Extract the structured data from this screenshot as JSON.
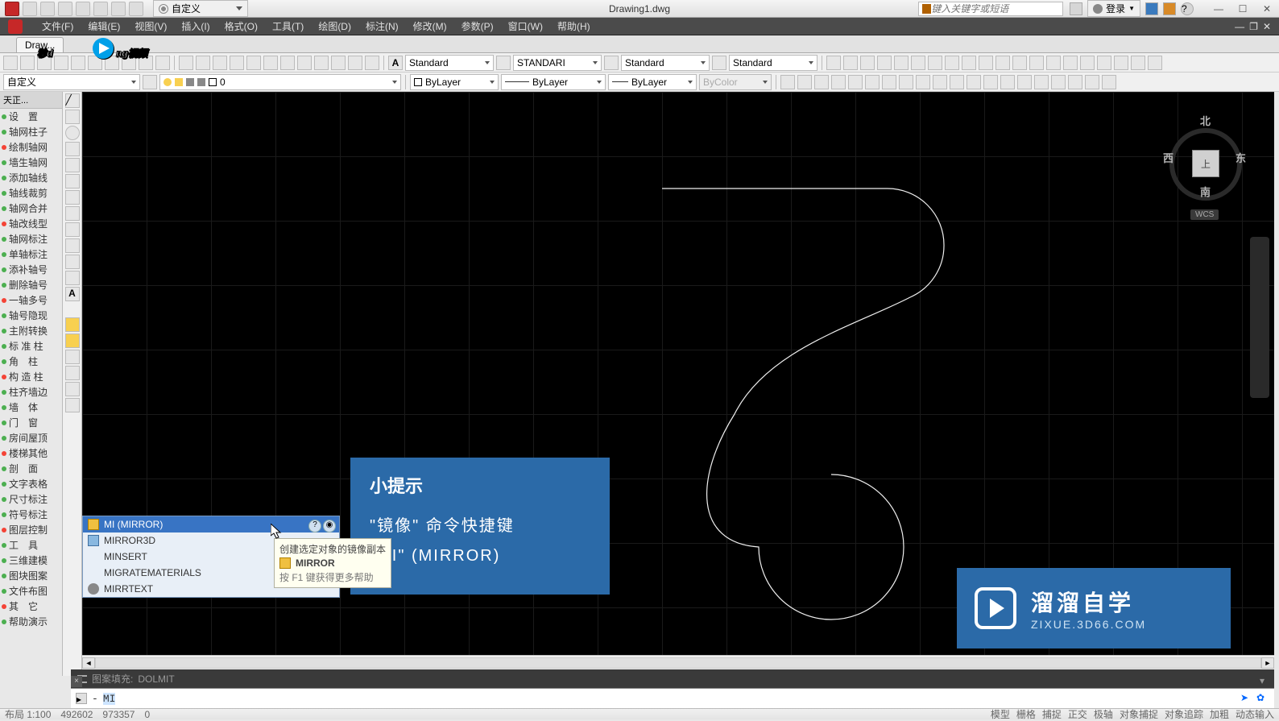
{
  "title_bar": {
    "workspace": "自定义",
    "document": "Drawing1.dwg",
    "search_placeholder": "键入关键字或短语",
    "login": "登录"
  },
  "menu": [
    "文件(F)",
    "编辑(E)",
    "视图(V)",
    "插入(I)",
    "格式(O)",
    "工具(T)",
    "绘图(D)",
    "标注(N)",
    "修改(M)",
    "参数(P)",
    "窗口(W)",
    "帮助(H)"
  ],
  "tab": {
    "label": "Draw..."
  },
  "toolbars": {
    "style_dd": [
      "Standard",
      "STANDARI",
      "Standard",
      "Standard"
    ],
    "layer_dd": "0",
    "props": {
      "color": "ByLayer",
      "linetype": "ByLayer",
      "lineweight": "ByLayer",
      "plotstyle": "ByColor"
    },
    "left_dd": "自定义"
  },
  "left_panel": {
    "title": "天正...",
    "items": [
      "设　置",
      "轴网柱子",
      "绘制轴网",
      "墙生轴网",
      "添加轴线",
      "轴线裁剪",
      "轴网合并",
      "轴改线型",
      "轴网标注",
      "单轴标注",
      "添补轴号",
      "删除轴号",
      "一轴多号",
      "轴号隐现",
      "主附转换",
      "标 准 柱",
      "角　柱",
      "构 造 柱",
      "柱齐墙边",
      "墙　体",
      "门　窗",
      "房间屋顶",
      "楼梯其他",
      "剖　面",
      "文字表格",
      "尺寸标注",
      "符号标注",
      "图层控制",
      "工　具",
      "三维建模",
      "图块图案",
      "文件布图",
      "其　它",
      "帮助演示"
    ]
  },
  "view_cube": {
    "n": "北",
    "s": "南",
    "e": "东",
    "w": "西",
    "top": "上",
    "wcs": "WCS"
  },
  "autocomplete": {
    "items": [
      {
        "text": "MI (MIRROR)",
        "selected": true,
        "icon": "mirror"
      },
      {
        "text": "MIRROR3D",
        "selected": false,
        "icon": "mirror3d"
      },
      {
        "text": "MINSERT",
        "selected": false,
        "icon": ""
      },
      {
        "text": "MIGRATEMATERIALS",
        "selected": false,
        "icon": ""
      },
      {
        "text": "MIRRTEXT",
        "selected": false,
        "icon": "sysvar"
      }
    ]
  },
  "tooltip_desc": {
    "line1": "创建选定对象的镜像副本",
    "cmd_label": "MIRROR",
    "line2": "按 F1 键获得更多帮助"
  },
  "tip_overlay": {
    "heading": "小提示",
    "line1": "\"镜像\" 命令快捷键",
    "line2": "\"MI\"  (MIRROR)"
  },
  "bottom_watermark": {
    "text1": "溜溜自学",
    "text2": "ZIXUE.3D66.COM"
  },
  "command": {
    "history_prefix": "图案填充:",
    "history_val": "DOLMIT",
    "input_prefix": "-",
    "input_text": "MI"
  },
  "status": {
    "left": [
      "布局 1:100",
      "492602",
      "973357",
      "0"
    ],
    "right": [
      "模型",
      "栅格",
      "捕捉",
      "正交",
      "极轴",
      "对象捕捉",
      "对象追踪",
      "加粗",
      "动态输入"
    ]
  }
}
